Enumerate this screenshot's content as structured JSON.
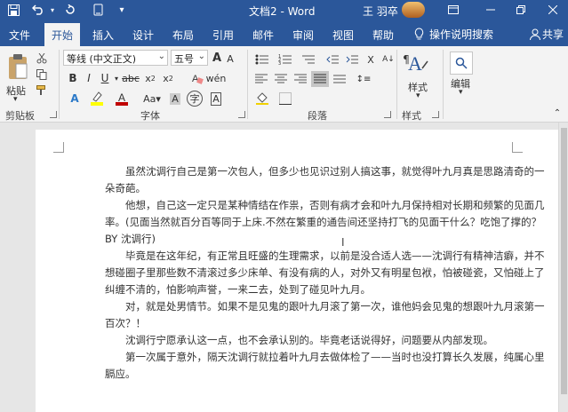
{
  "titlebar": {
    "doc_title": "文档2 - Word",
    "user_name": "王 羽卒"
  },
  "tabs": [
    "文件",
    "开始",
    "插入",
    "设计",
    "布局",
    "引用",
    "邮件",
    "审阅",
    "视图",
    "帮助"
  ],
  "active_tab": "开始",
  "tell_me": "操作说明搜索",
  "share": "共享",
  "ribbon": {
    "clipboard": {
      "paste": "粘贴",
      "label": "剪贴板"
    },
    "font": {
      "font_name": "等线 (中文正文)",
      "font_size": "五号",
      "grow_font": "A",
      "shrink_font": "A",
      "label": "字体"
    },
    "paragraph": {
      "label": "段落"
    },
    "styles": {
      "button": "样式",
      "label": "样式"
    },
    "editing": {
      "button": "编辑"
    }
  },
  "document": {
    "paragraphs": [
      "虽然沈调行自己是第一次包人，但多少也见识过别人搞这事，就觉得叶九月真是思路清奇的一朵奇葩。",
      "他想，自己这一定只是某种情结在作祟，否则有病才会和叶九月保持相对长期和频繁的见面几率。(见面当然就百分百等同于上床.不然在繁重的通告间还坚持打飞的见面干什么？吃饱了撑的？BY 沈调行)",
      "毕竟是在这年纪，有正常且旺盛的生理需求，以前是没合适人选——沈调行有精神洁癖，并不想碰圈子里那些数不清滚过多少床单、有没有病的人，对外又有明星包袱，怕被碰瓷，又怕碰上了纠缠不清的，怕影响声誉，一来二去，处到了碰见叶九月。",
      "对，就是处男情节。如果不是见鬼的跟叶九月滚了第一次，谁他妈会见鬼的想跟叶九月滚第一百次？！",
      "沈调行宁愿承认这一点，也不会承认别的。毕竟老话说得好，问题要从内部发现。",
      "第一次属于意外，隔天沈调行就拉着叶九月去做体检了——当时也没打算长久发展，纯属心里膈应。"
    ]
  },
  "colors": {
    "brand": "#2b579a",
    "ribbon_bg": "#f3f3f3",
    "highlight": "#ffff00",
    "font_color": "#c00000"
  },
  "icons": {
    "save": "save-icon",
    "undo": "undo-icon",
    "redo": "redo-icon",
    "customize": "customize-qat-icon",
    "tell_me": "lightbulb-icon",
    "share": "person-icon"
  }
}
